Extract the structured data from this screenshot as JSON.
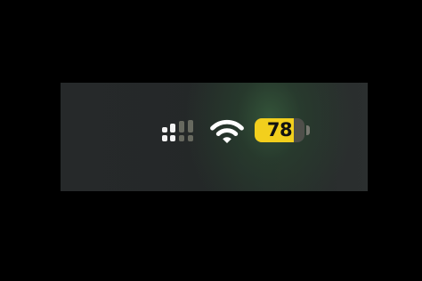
{
  "status_bar": {
    "cellular": {
      "icon": "cellular-signal-icon",
      "bars_active": 2,
      "bars_total": 4,
      "active_color": "#f2f2f2",
      "inactive_color": "#67695f"
    },
    "wifi": {
      "icon": "wifi-icon",
      "color": "#ffffff"
    },
    "battery": {
      "icon": "battery-icon",
      "percent": "78",
      "level": 0.78,
      "fill_color": "#f2cf1d"
    }
  }
}
